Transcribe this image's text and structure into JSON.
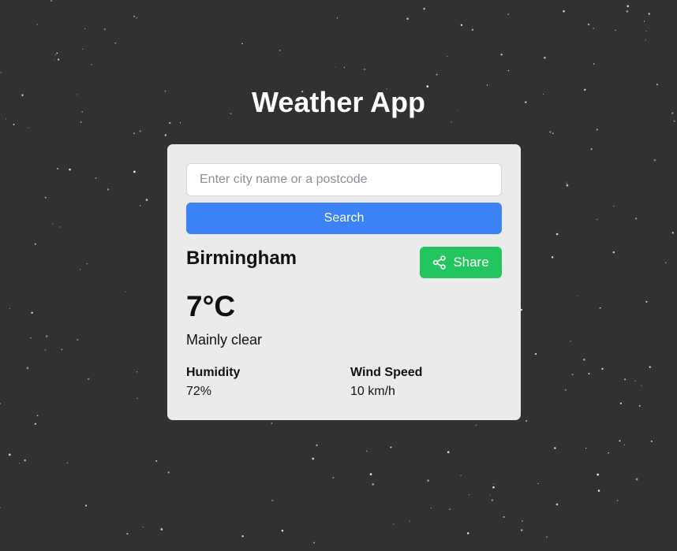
{
  "app": {
    "title": "Weather App"
  },
  "search": {
    "placeholder": "Enter city name or a postcode",
    "value": "",
    "button_label": "Search"
  },
  "weather": {
    "city": "Birmingham",
    "temperature": "7°C",
    "description": "Mainly clear",
    "humidity_label": "Humidity",
    "humidity_value": "72%",
    "wind_label": "Wind Speed",
    "wind_value": "10 km/h"
  },
  "share": {
    "label": "Share",
    "icon": "share-icon"
  },
  "colors": {
    "background": "#313131",
    "card": "#ebebeb",
    "search_button": "#3b82f6",
    "share_button": "#22c55e"
  }
}
